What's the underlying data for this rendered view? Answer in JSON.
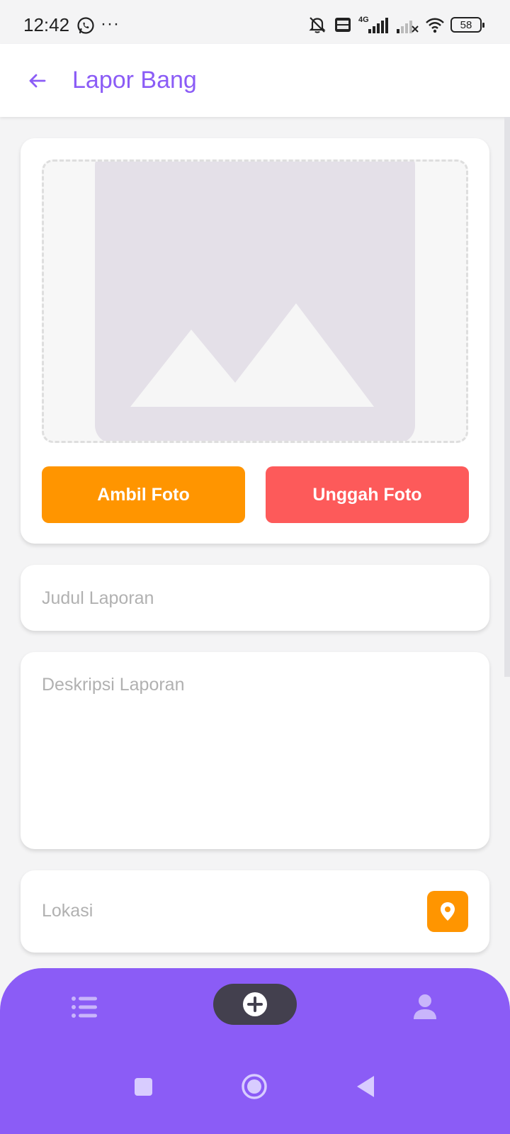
{
  "status_bar": {
    "time": "12:42",
    "more": "···",
    "network": "4G",
    "battery": "58",
    "icons": [
      "whatsapp-icon",
      "bell-off-icon",
      "volte-icon",
      "signal-icon",
      "signal-weak-icon",
      "wifi-icon",
      "battery-icon"
    ]
  },
  "app_bar": {
    "title": "Lapor Bang",
    "back_icon": "arrow-left-icon"
  },
  "photo": {
    "placeholder_icon": "image-placeholder-icon",
    "take_photo_label": "Ambil Foto",
    "upload_photo_label": "Unggah Foto"
  },
  "form": {
    "title_placeholder": "Judul Laporan",
    "description_placeholder": "Deskripsi Laporan",
    "location_placeholder": "Lokasi",
    "location_icon": "map-pin-icon"
  },
  "bottom_nav": {
    "items": [
      "list-icon",
      "add-circle-icon",
      "user-icon"
    ]
  },
  "colors": {
    "primary": "#8b5cf6",
    "orange": "#ff9500",
    "red": "#fd5a5a",
    "dark_pill": "#43404e"
  }
}
